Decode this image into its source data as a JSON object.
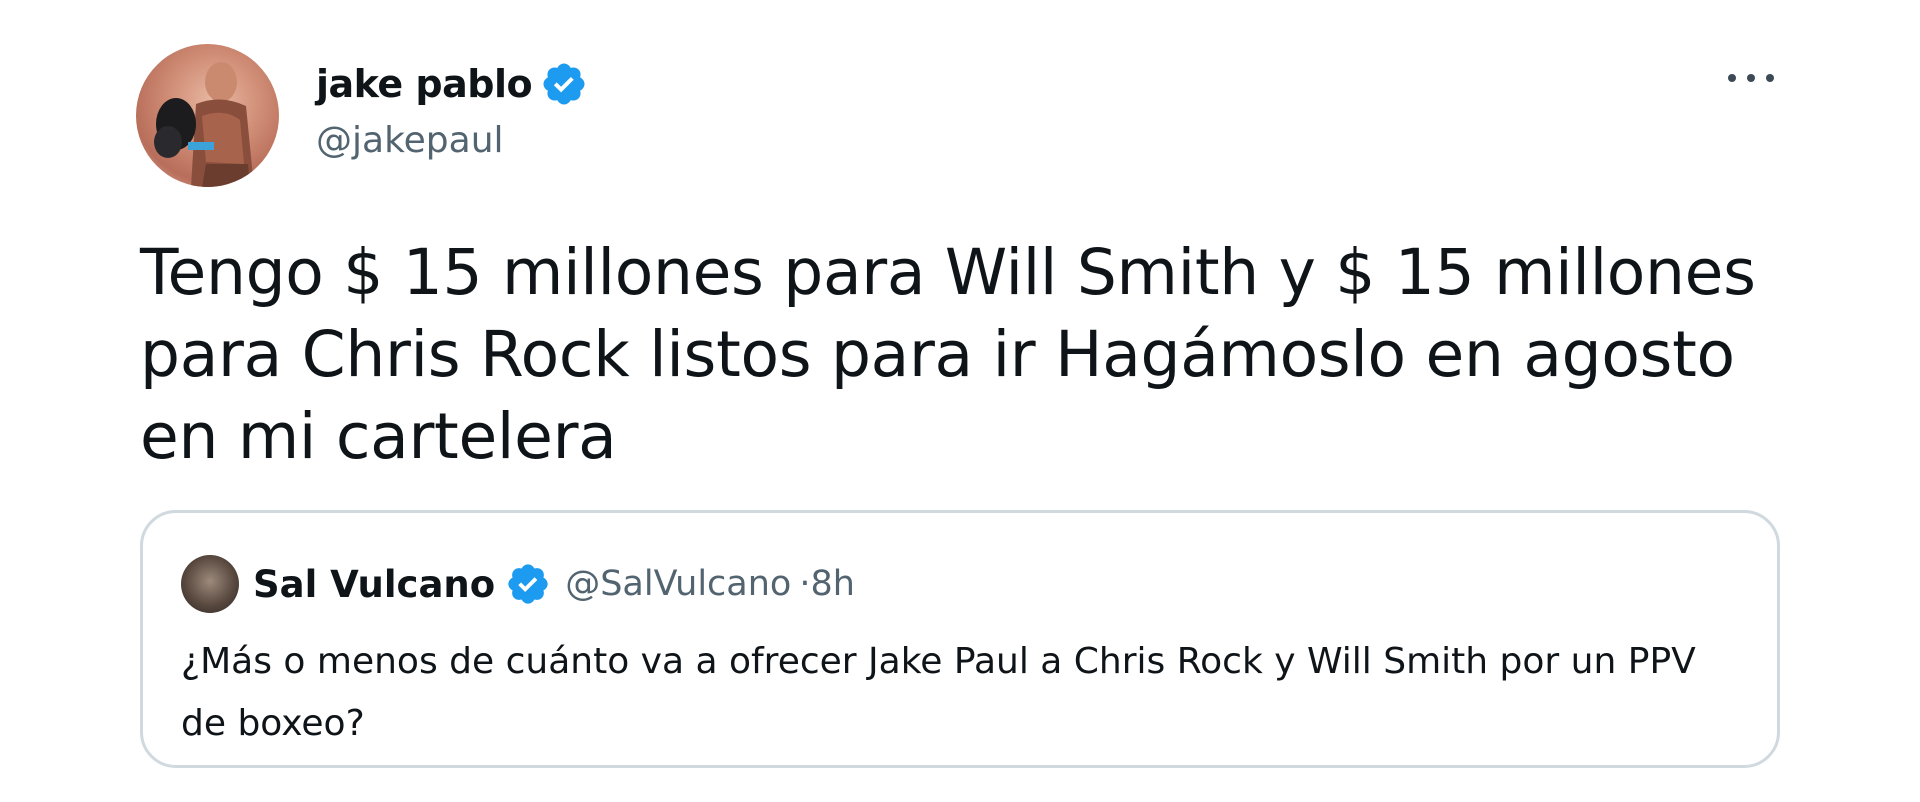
{
  "tweet": {
    "author": {
      "display_name": "jake pablo",
      "handle": "@jakepaul",
      "verified": true
    },
    "text": "Tengo $ 15 millones para Will Smith y $ 15 millones para Chris Rock listos para ir Hagámoslo en agosto en mi cartelera",
    "menu_icon": "more-horizontal-icon"
  },
  "quoted_tweet": {
    "author": {
      "display_name": "Sal Vulcano",
      "handle": "@SalVulcano",
      "verified": true
    },
    "time": "·8h",
    "text": "¿Más o menos de cuánto va a ofrecer Jake Paul a Chris Rock y Will Smith por un PPV de boxeo?"
  },
  "colors": {
    "verified_blue": "#1d9bf0",
    "secondary_text": "#536471",
    "border": "#cfd9de"
  }
}
